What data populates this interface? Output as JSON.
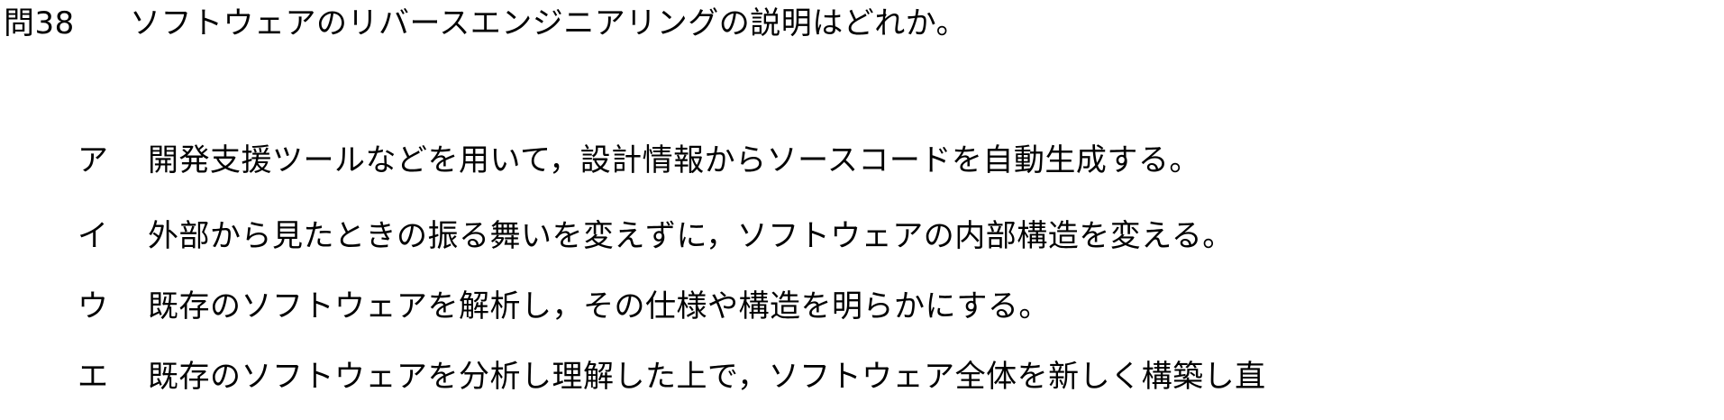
{
  "question": {
    "number": "問38",
    "text": "ソフトウェアのリバースエンジニアリングの説明はどれか。"
  },
  "choices": [
    {
      "label": "ア",
      "text": "開発支援ツールなどを用いて，設計情報からソースコードを自動生成する。"
    },
    {
      "label": "イ",
      "text": "外部から見たときの振る舞いを変えずに，ソフトウェアの内部構造を変える。"
    },
    {
      "label": "ウ",
      "text": "既存のソフトウェアを解析し，その仕様や構造を明らかにする。"
    },
    {
      "label": "エ",
      "text": "既存のソフトウェアを分析し理解した上で，ソフトウェア全体を新しく構築し直"
    }
  ]
}
